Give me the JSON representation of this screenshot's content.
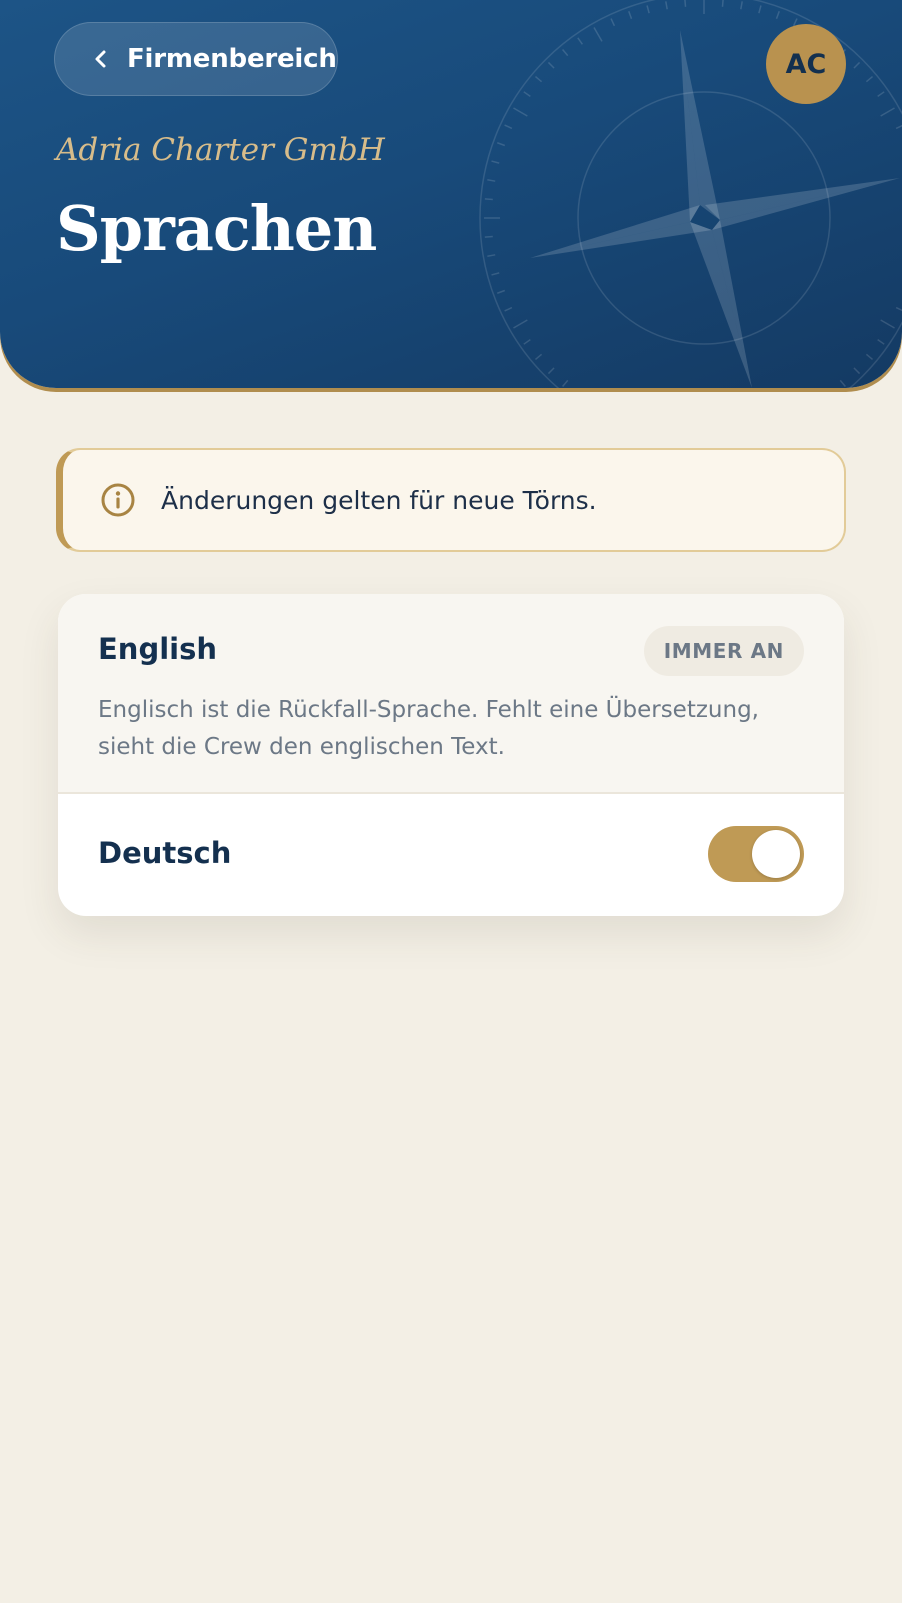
{
  "header": {
    "back_label": "Firmenbereich",
    "avatar_initials": "AC",
    "company": "Adria Charter GmbH",
    "title": "Sprachen"
  },
  "notice": {
    "icon": "info-icon",
    "text": "Änderungen gelten für neue Törns."
  },
  "languages": [
    {
      "name": "English",
      "badge": "IMMER AN",
      "description": "Englisch ist die Rückfall-Sprache. Fehlt eine Übersetzung, sieht die Crew den englischen Text."
    },
    {
      "name": "Deutsch",
      "enabled": true
    }
  ],
  "colors": {
    "header_blue": "#1a4c7c",
    "gold": "#bf9a55",
    "background": "#f3efe5",
    "navy_text": "#14304f"
  }
}
